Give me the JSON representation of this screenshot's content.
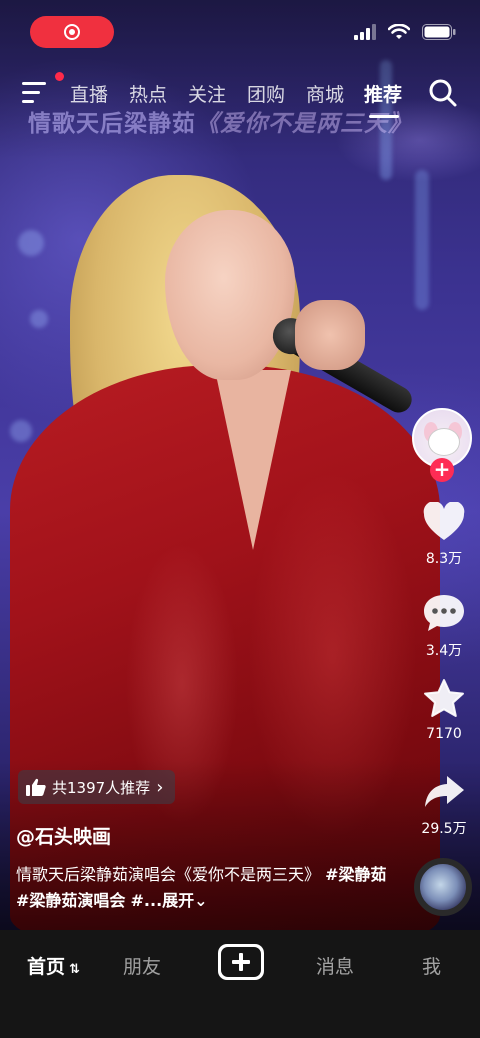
{
  "video": {
    "caption_prefix": "情歌天后梁静茹",
    "caption_song": "《爱你不是两三天》"
  },
  "status_bar": {
    "icons": [
      "record-icon",
      "signal-icon",
      "wifi-icon",
      "battery-icon"
    ]
  },
  "top_nav": {
    "tabs": [
      {
        "label": "直播",
        "active": false
      },
      {
        "label": "热点",
        "active": false
      },
      {
        "label": "关注",
        "active": false
      },
      {
        "label": "团购",
        "active": false
      },
      {
        "label": "商城",
        "active": false
      },
      {
        "label": "推荐",
        "active": true
      }
    ],
    "accent_color": "#fe2c55"
  },
  "rail": {
    "likes": "8.3万",
    "comments": "3.4万",
    "favorites": "7170",
    "shares": "29.5万",
    "follow_symbol": "+"
  },
  "post": {
    "recommend_text": "共1397人推荐",
    "recommend_arrow": "›",
    "author": "@石头映画",
    "desc_text": "情歌天后梁静茹演唱会《爱你不是两三天》 ",
    "tags": [
      "#梁静茹",
      "#梁静茹演唱会",
      "#..."
    ],
    "expand_label": "展开⌄"
  },
  "tabbar": {
    "home": "首页",
    "home_suffix": "⇅",
    "friends": "朋友",
    "messages": "消息",
    "me": "我"
  }
}
